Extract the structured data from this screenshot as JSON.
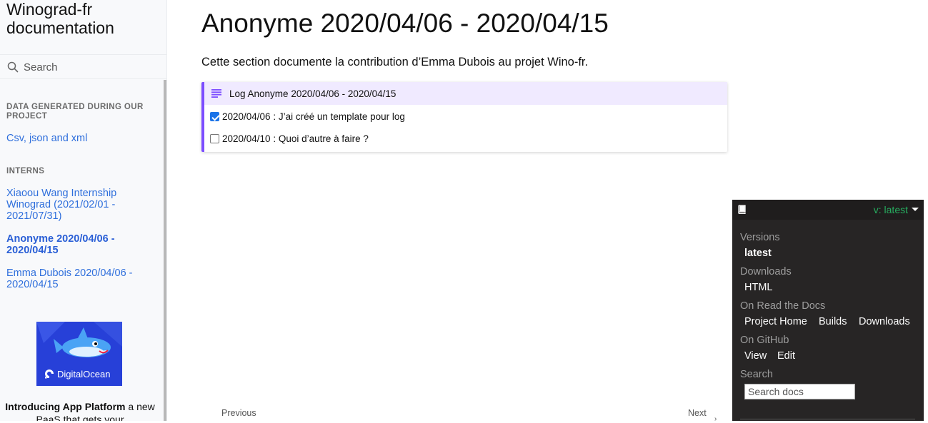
{
  "sidebar": {
    "brand": "Winograd-fr documentation",
    "search_placeholder": "Search",
    "sections": [
      {
        "caption": "DATA GENERATED DURING OUR PROJECT",
        "items": [
          "Csv, json and xml"
        ]
      },
      {
        "caption": "INTERNS",
        "items": [
          "Xiaoou Wang Internship Winograd (2021/02/01 - 2021/07/31)",
          "Anonyme 2020/04/06 - 2020/04/15",
          "Emma Dubois 2020/04/06 - 2020/04/15"
        ]
      }
    ],
    "ad": {
      "brand": "DigitalOcean",
      "headline_bold": "Introducing App Platform",
      "headline_rest": " a new PaaS that gets your"
    }
  },
  "main": {
    "title": "Anonyme 2020/04/06 - 2020/04/15",
    "intro": "Cette section documente la contribution d’Emma Dubois au projet Wino-fr.",
    "admonition": {
      "title": "Log Anonyme 2020/04/06 - 2020/04/15",
      "tasks": [
        {
          "text": "2020/04/06 : J’ai créé un template pour log",
          "checked": true
        },
        {
          "text": "2020/04/10 : Quoi d’autre à faire ?",
          "checked": false
        }
      ]
    },
    "footer_nav": {
      "previous": "Previous",
      "next": "Next"
    }
  },
  "rtd": {
    "current_version": "v: latest",
    "versions_label": "Versions",
    "versions": [
      "latest"
    ],
    "downloads_label": "Downloads",
    "downloads": [
      "HTML"
    ],
    "on_rtd_label": "On Read the Docs",
    "on_rtd": [
      "Project Home",
      "Builds",
      "Downloads"
    ],
    "github_label": "On GitHub",
    "github": [
      "View",
      "Edit"
    ],
    "search_label": "Search",
    "search_placeholder": "Search docs"
  },
  "colors": {
    "link": "#2f6fdc",
    "admonition_accent": "#7c4dff",
    "admonition_bg": "#f0eaff",
    "rtd_bg": "#272525",
    "rtd_version": "#27ae60"
  }
}
